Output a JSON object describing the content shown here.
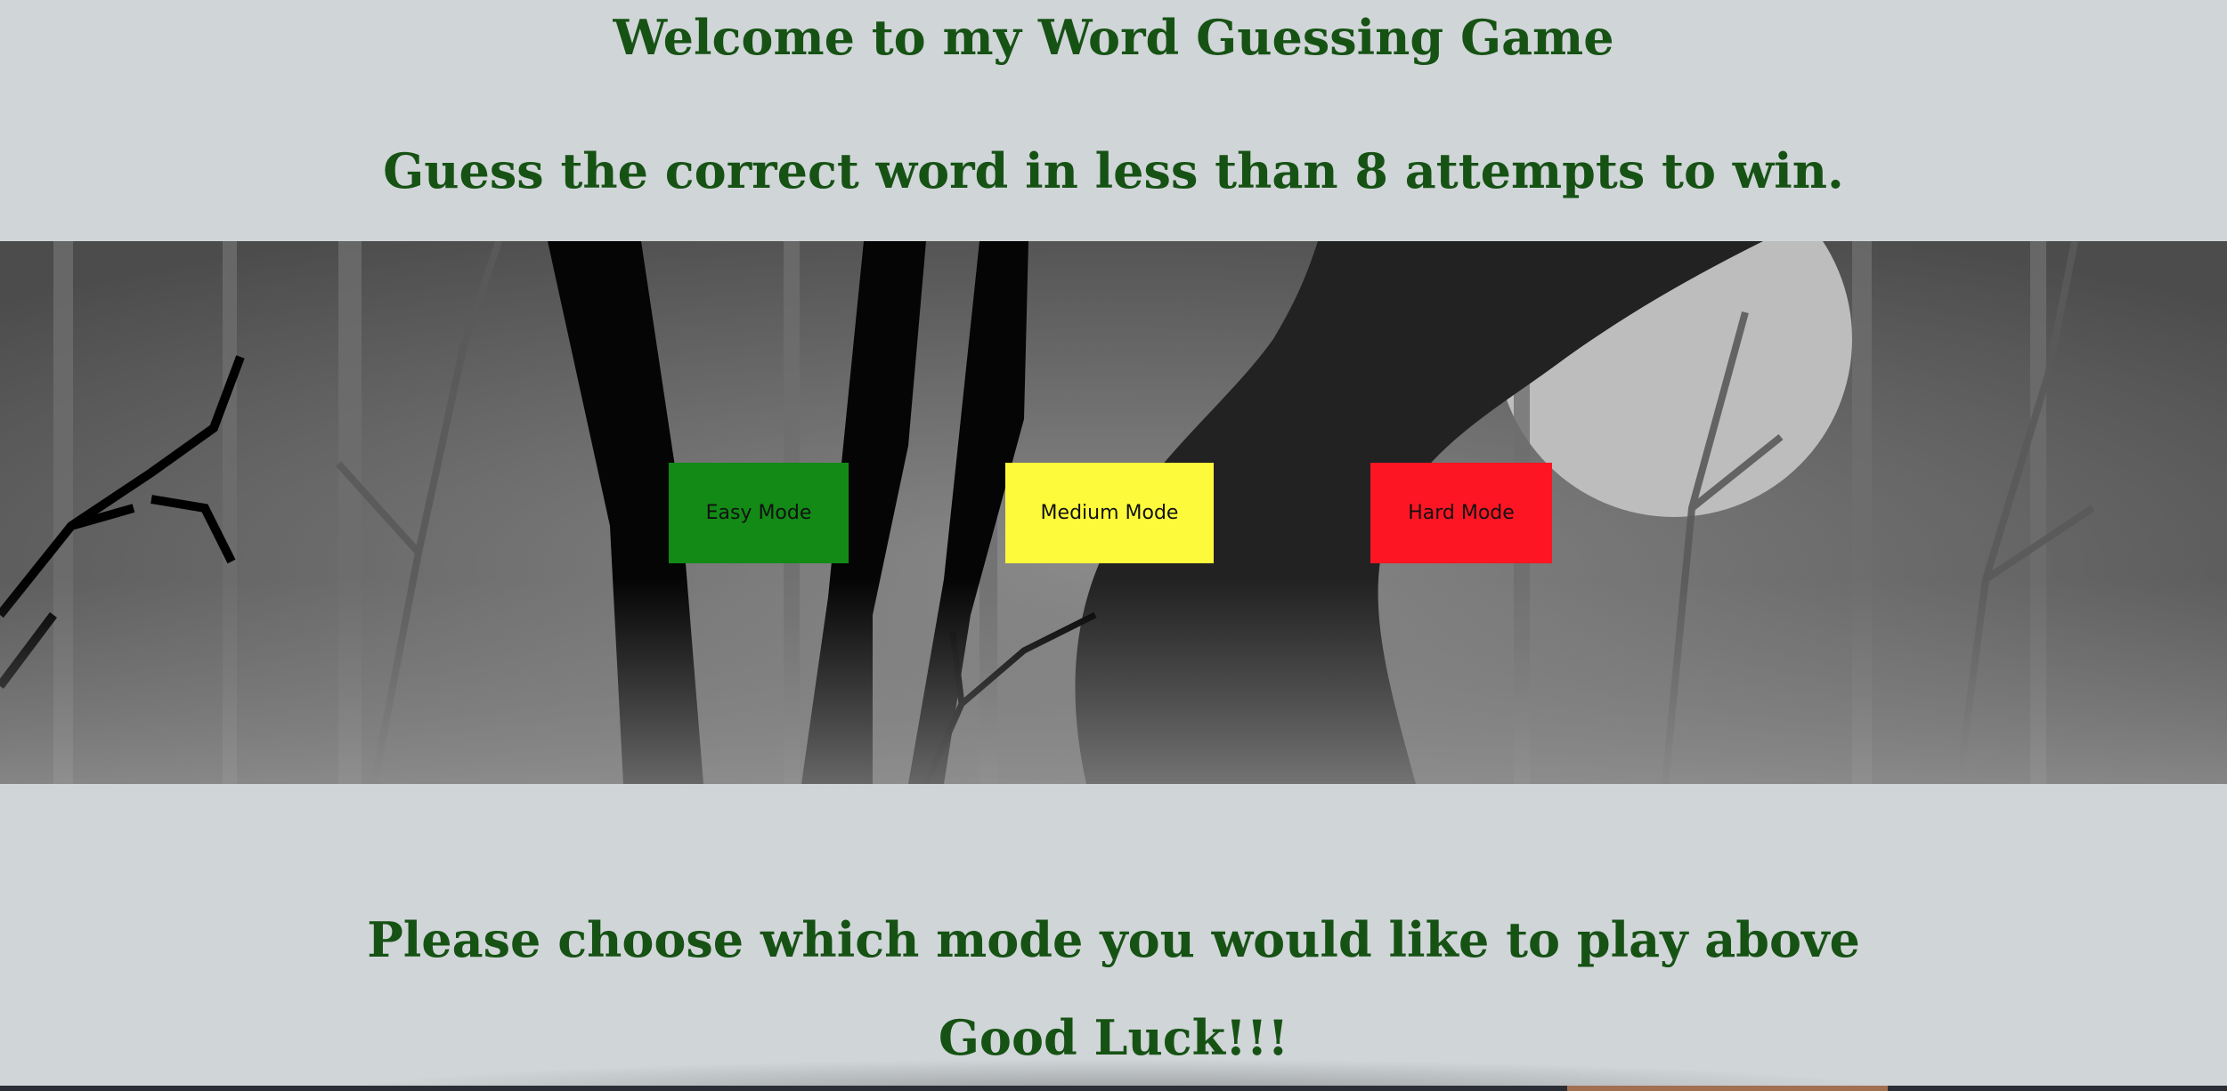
{
  "header": {
    "title": "Welcome to my Word Guessing Game",
    "instructions": "Guess the correct word in less than 8 attempts to win."
  },
  "modes": {
    "easy_label": "Easy Mode",
    "medium_label": "Medium Mode",
    "hard_label": "Hard Mode"
  },
  "footer": {
    "prompt": "Please choose which mode you would like to play above",
    "farewell": "Good Luck!!!"
  },
  "colors": {
    "background": "#d0d5d8",
    "heading": "#165214",
    "easy": "#138a16",
    "medium": "#fdfa3b",
    "hard": "#fd1524"
  }
}
